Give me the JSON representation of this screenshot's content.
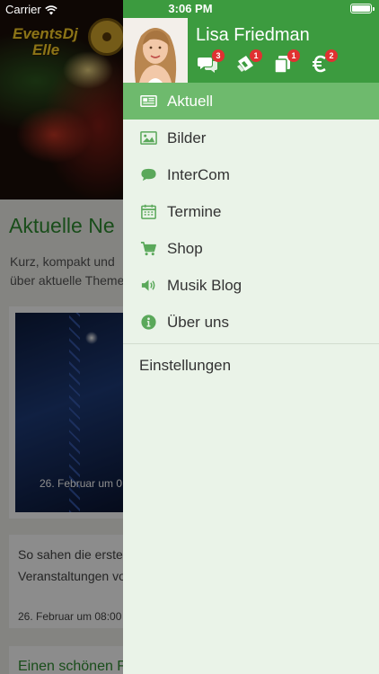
{
  "status_bar": {
    "carrier": "Carrier",
    "time": "3:06 PM"
  },
  "background_page": {
    "logo_line1": "EventsDj",
    "logo_line2": "Elle",
    "section_title": "Aktuelle Ne",
    "intro_line1": "Kurz, kompakt und",
    "intro_line2": "über aktuelle Theme",
    "card1_date": "26. Februar um 0",
    "card2_line1": "So sahen die erste",
    "card2_line2": "Veranstaltungen vo",
    "card2_date": "26. Februar um 08:00",
    "card3_title": "Einen schönen F"
  },
  "drawer": {
    "user_name": "Lisa Friedman",
    "header_badges": {
      "messages": "3",
      "tickets": "1",
      "copies": "1",
      "euro": "2"
    },
    "menu_items": [
      {
        "label": "Aktuell",
        "icon": "newspaper-icon",
        "active": true
      },
      {
        "label": "Bilder",
        "icon": "image-icon",
        "active": false
      },
      {
        "label": "InterCom",
        "icon": "speech-bubble-icon",
        "active": false
      },
      {
        "label": "Termine",
        "icon": "calendar-icon",
        "active": false
      },
      {
        "label": "Shop",
        "icon": "cart-icon",
        "active": false
      },
      {
        "label": "Musik Blog",
        "icon": "speaker-icon",
        "active": false
      },
      {
        "label": "Über uns",
        "icon": "info-icon",
        "active": false
      }
    ],
    "settings_label": "Einstellungen"
  },
  "colors": {
    "header_green": "#3c9b3f",
    "active_green": "#6eba6d",
    "icon_green": "#5aa85a",
    "drawer_bg": "#eaf3e8",
    "badge_red": "#e03131"
  }
}
